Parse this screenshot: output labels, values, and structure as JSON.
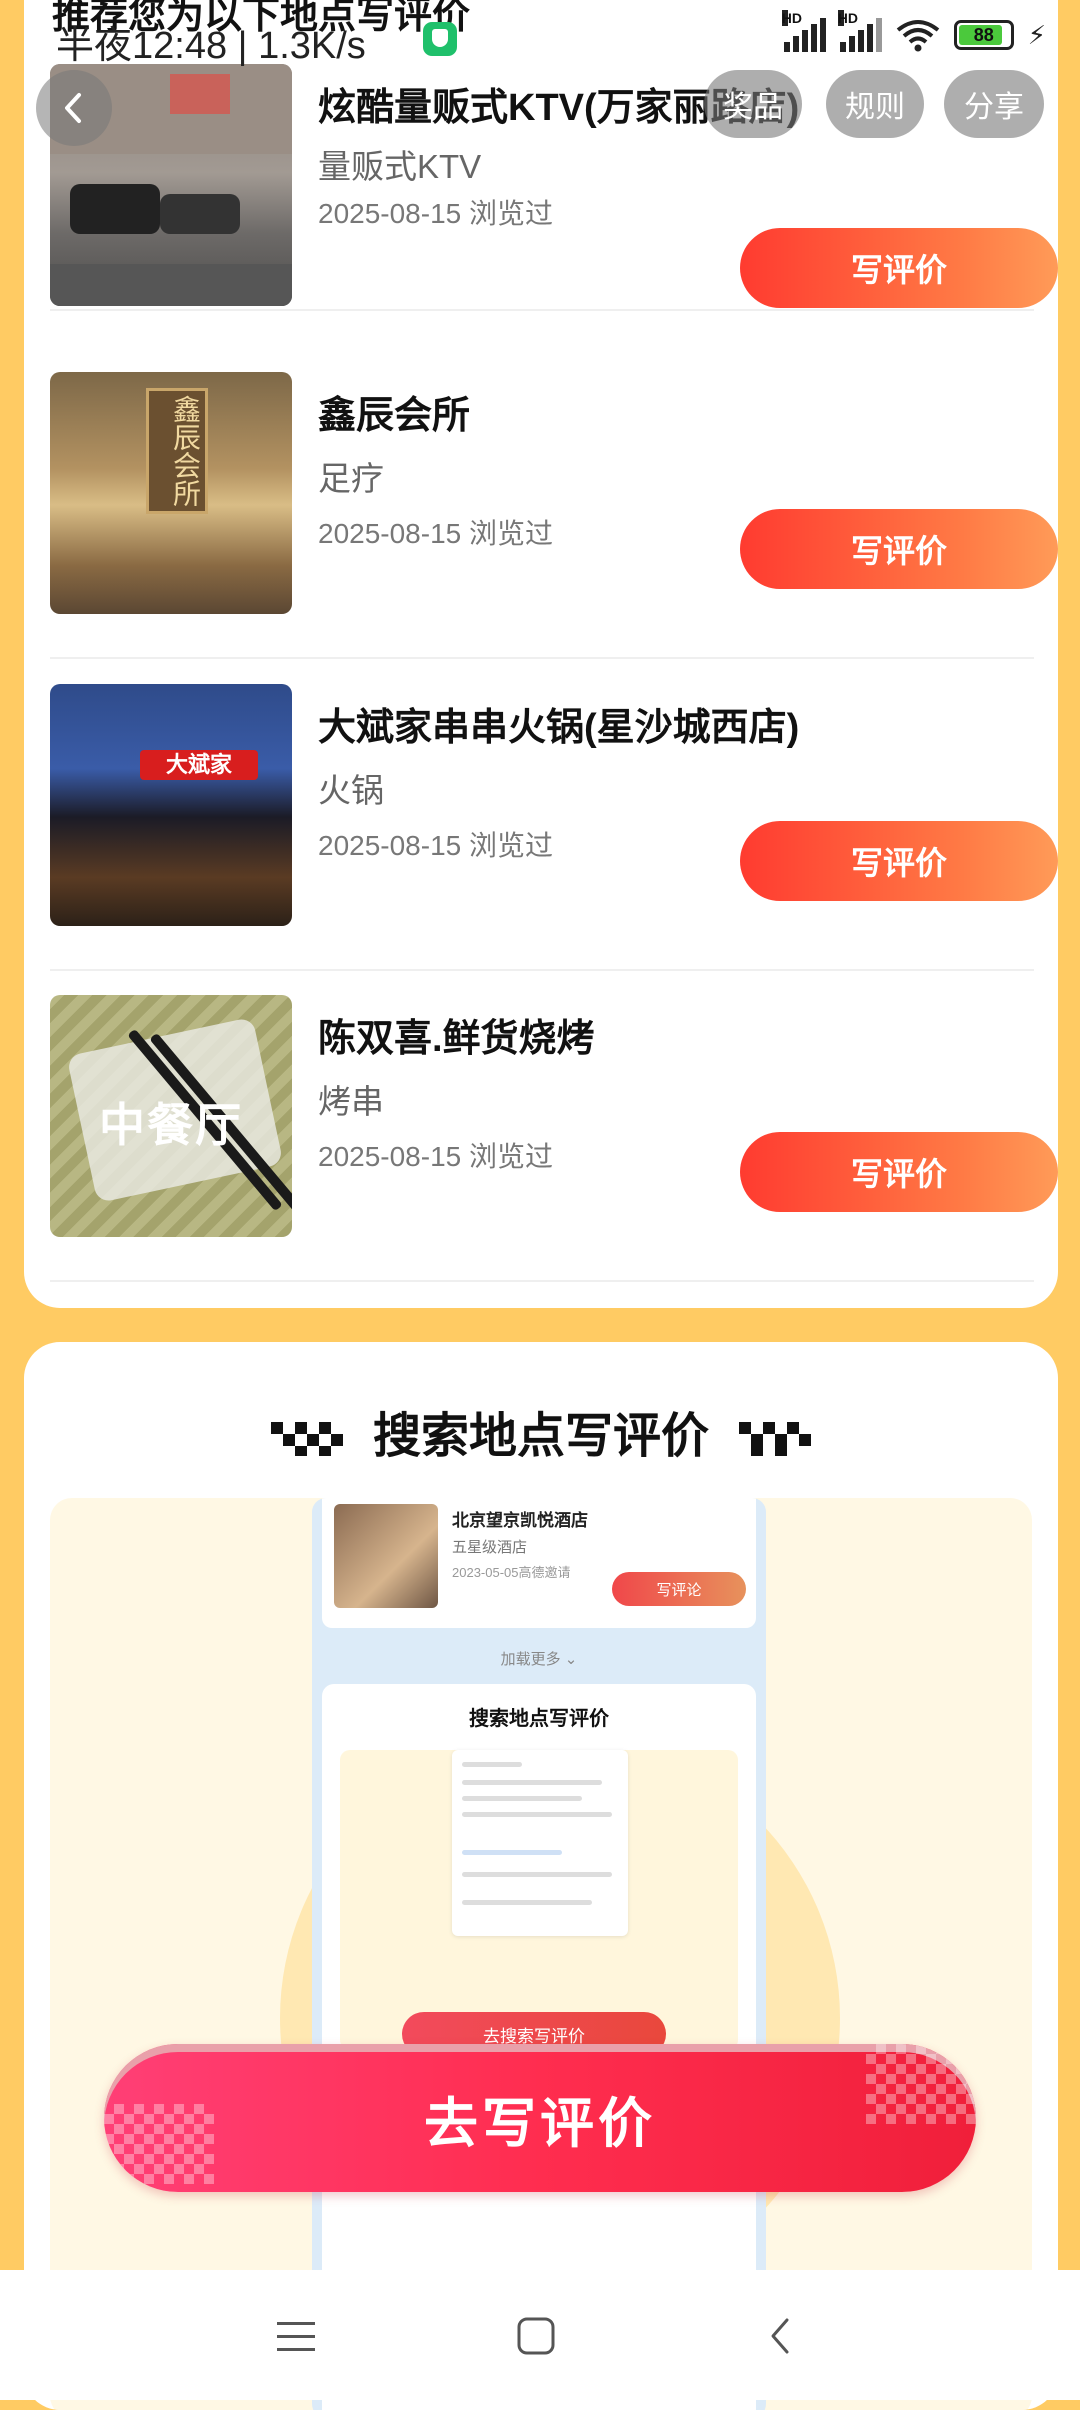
{
  "status_bar": {
    "time": "半夜12:48 | 1.3K/s",
    "battery": "88"
  },
  "page": {
    "heading": "推荐您为以下地点写评价"
  },
  "top_buttons": {
    "pill1": "奖品",
    "rules": "规则",
    "share": "分享"
  },
  "list": {
    "action_label": "写评价",
    "items": [
      {
        "name": "炫酷量贩式KTV(万家丽路店)",
        "category": "量贩式KTV",
        "date": "2025-08-15 浏览过"
      },
      {
        "name": "鑫辰会所",
        "category": "足疗",
        "date": "2025-08-15 浏览过"
      },
      {
        "name": "大斌家串串火锅(星沙城西店)",
        "category": "火锅",
        "date": "2025-08-15 浏览过"
      },
      {
        "name": "陈双喜.鲜货烧烤",
        "category": "烤串",
        "date": "2025-08-15 浏览过",
        "image_label": "中餐厅"
      }
    ],
    "signs": {
      "xinchen": "鑫辰会所",
      "dabin": "大斌家"
    }
  },
  "search_section": {
    "title": "搜索地点写评价",
    "preview": {
      "place_name": "北京望京凯悦酒店",
      "place_category": "五星级酒店",
      "place_date": "2023-05-05高德邀请",
      "write_comment": "写评论",
      "load_more": "加载更多",
      "inner_title": "搜索地点写评价",
      "cta": "去搜索写评价"
    }
  },
  "cta": {
    "label": "去写评价"
  },
  "colors": {
    "page_bg": "#FFCB63",
    "button_orange": "#FF5A3C",
    "cta_pink": "#FF2D4F",
    "highlight_green": "#DFF348"
  },
  "icons": {
    "back": "chevron-left-icon",
    "nav_menu": "menu-icon",
    "nav_home": "home-square-icon",
    "nav_back": "back-chevron-icon"
  }
}
